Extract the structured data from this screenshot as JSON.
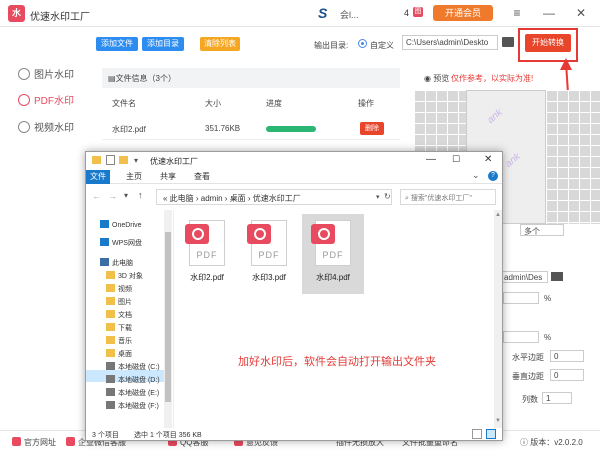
{
  "app": {
    "title": "优速水印工厂",
    "logo_text": "水",
    "user": "会l...",
    "badge_num": "4",
    "badge_mark": "图",
    "vip_label": "开通会员",
    "win_menu": "≡",
    "win_min": "—",
    "win_close": "✕"
  },
  "sidebar": {
    "items": [
      {
        "label": "图片水印"
      },
      {
        "label": "PDF水印"
      },
      {
        "label": "视频水印"
      }
    ]
  },
  "toolbar": {
    "add_file": "添加文件",
    "add_dir": "添加目录",
    "clear_list": "清除列表",
    "output_label": "输出目录:",
    "custom_label": "自定义",
    "output_path": "C:\\Users\\admin\\Deskto",
    "start_label": "开始转换"
  },
  "table": {
    "info": "文件信息（3个）",
    "headers": [
      "文件名",
      "大小",
      "进度",
      "操作"
    ],
    "rows": [
      {
        "name": "水印2.pdf",
        "size": "351.76KB",
        "progress": 1.0,
        "action": "删除"
      }
    ]
  },
  "preview": {
    "label": "预览",
    "note": "仅作参考，以实际为准!",
    "watermark": "ank"
  },
  "settings": {
    "select_value": "多个",
    "path_value": "admin\\Des",
    "percent": "%",
    "h_margin_label": "水平边距",
    "h_margin": "0",
    "v_margin_label": "垂直边距",
    "v_margin": "0",
    "cols_label": "列数",
    "cols": "1"
  },
  "bottom": {
    "items": [
      "官方网址",
      "企业微信客服",
      "QQ客服",
      "意见反馈",
      "插件无损放大",
      "文件批量重命名"
    ],
    "version": "版本：v2.0.2.0"
  },
  "explorer": {
    "title": "优速水印工厂",
    "tabs": [
      "文件",
      "主页",
      "共享",
      "查看"
    ],
    "address": [
      "此电脑",
      "admin",
      "桌面",
      "优速水印工厂"
    ],
    "search_placeholder": "搜索\"优速水印工厂\"",
    "nav": [
      {
        "label": "OneDrive",
        "icon": "cloud"
      },
      {
        "label": "WPS网盘",
        "icon": "cloud"
      },
      {
        "label": "此电脑",
        "icon": "pc"
      },
      {
        "label": "3D 对象",
        "icon": "folder"
      },
      {
        "label": "视频",
        "icon": "folder"
      },
      {
        "label": "图片",
        "icon": "folder"
      },
      {
        "label": "文档",
        "icon": "folder"
      },
      {
        "label": "下载",
        "icon": "folder"
      },
      {
        "label": "音乐",
        "icon": "folder"
      },
      {
        "label": "桌面",
        "icon": "folder"
      },
      {
        "label": "本地磁盘 (C:)",
        "icon": "drive"
      },
      {
        "label": "本地磁盘 (D:)",
        "icon": "drive"
      },
      {
        "label": "本地磁盘 (E:)",
        "icon": "drive"
      },
      {
        "label": "本地磁盘 (F:)",
        "icon": "drive"
      }
    ],
    "files": [
      {
        "name": "水印2.pdf"
      },
      {
        "name": "水印3.pdf"
      },
      {
        "name": "水印4.pdf"
      }
    ],
    "pdf_label": "PDF",
    "note": "加好水印后，软件会自动打开输出文件夹",
    "status": [
      "3 个项目",
      "选中 1 个项目  356 KB"
    ],
    "ribbon_caret": "⌄",
    "help": "?"
  }
}
